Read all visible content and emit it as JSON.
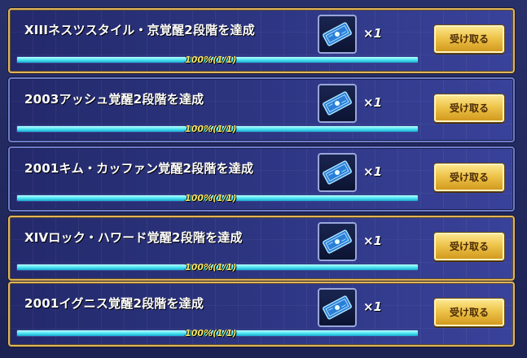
{
  "missions": [
    {
      "title": "XIIIネスツスタイル・京覚醒2段階を達成",
      "reward_icon": "awakening-ticket-icon",
      "reward_qty": "×1",
      "progress_text": "100%(1/1)",
      "progress_fraction": 1.0,
      "claim_label": "受け取る",
      "highlighted": true
    },
    {
      "title": "2003アッシュ覚醒2段階を達成",
      "reward_icon": "awakening-ticket-icon",
      "reward_qty": "×1",
      "progress_text": "100%(1/1)",
      "progress_fraction": 1.0,
      "claim_label": "受け取る",
      "highlighted": false
    },
    {
      "title": "2001キム・カッファン覚醒2段階を達成",
      "reward_icon": "awakening-ticket-icon",
      "reward_qty": "×1",
      "progress_text": "100%(1/1)",
      "progress_fraction": 1.0,
      "claim_label": "受け取る",
      "highlighted": false
    },
    {
      "title": "XIVロック・ハワード覚醒2段階を達成",
      "reward_icon": "awakening-ticket-icon",
      "reward_qty": "×1",
      "progress_text": "100%(1/1)",
      "progress_fraction": 1.0,
      "claim_label": "受け取る",
      "highlighted": true
    },
    {
      "title": "2001イグニス覚醒2段階を達成",
      "reward_icon": "awakening-ticket-icon",
      "reward_qty": "×1",
      "progress_text": "100%(1/1)",
      "progress_fraction": 1.0,
      "claim_label": "受け取る",
      "highlighted": true
    }
  ],
  "colors": {
    "highlight_border": "#e2b55a",
    "progress_fill": "#49e1f0",
    "progress_text": "#f6e36b",
    "button_gold": "#eec34a"
  }
}
